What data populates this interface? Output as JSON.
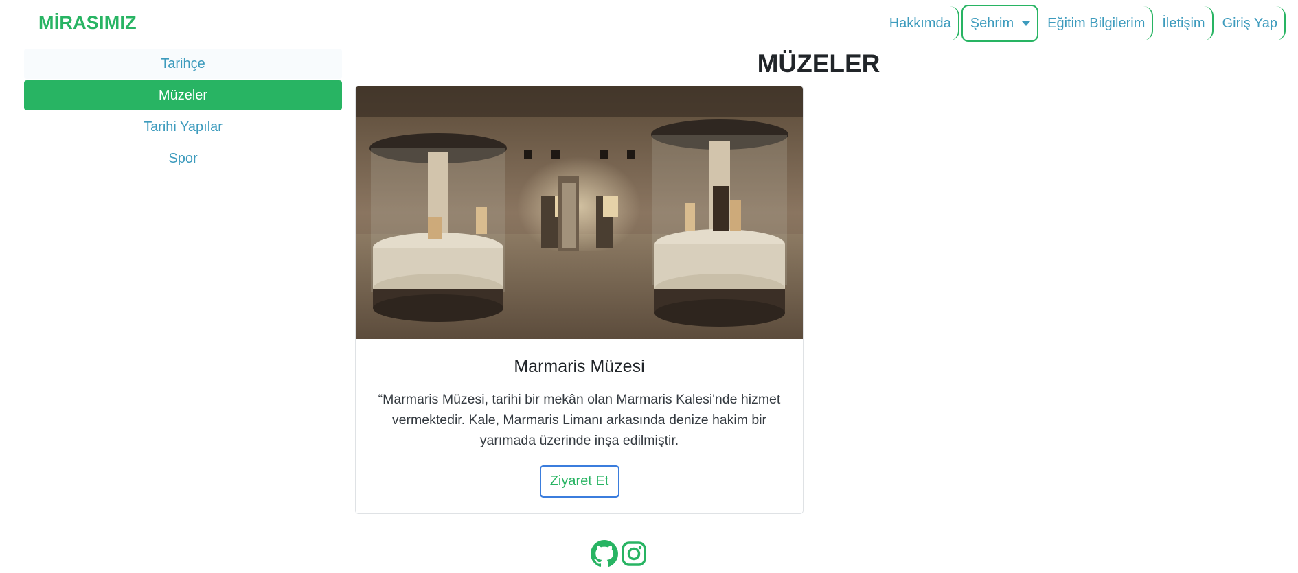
{
  "brand": {
    "name": "MİRASIMIZ"
  },
  "nav": {
    "items": [
      {
        "label": "Hakkımda"
      },
      {
        "label": "Şehrim"
      },
      {
        "label": "Eğitim Bilgilerim"
      },
      {
        "label": "İletişim"
      },
      {
        "label": "Giriş Yap"
      }
    ]
  },
  "sidebar": {
    "items": [
      {
        "label": "Tarihçe"
      },
      {
        "label": "Müzeler"
      },
      {
        "label": "Tarihi Yapılar"
      },
      {
        "label": "Spor"
      }
    ]
  },
  "main": {
    "title": "MÜZELER",
    "card": {
      "title": "Marmaris Müzesi",
      "text": "“Marmaris Müzesi, tarihi bir mekân olan Marmaris Kalesi'nde hizmet vermektedir. Kale, Marmaris Limanı arkasında denize hakim bir yarımada üzerinde inşa edilmiştir.",
      "button": "Ziyaret Et"
    }
  },
  "footer": {
    "icons": [
      "github-icon",
      "instagram-icon"
    ]
  },
  "colors": {
    "accent": "#28b463",
    "link": "#3d9bbd",
    "button_border": "#3b7ddd"
  }
}
